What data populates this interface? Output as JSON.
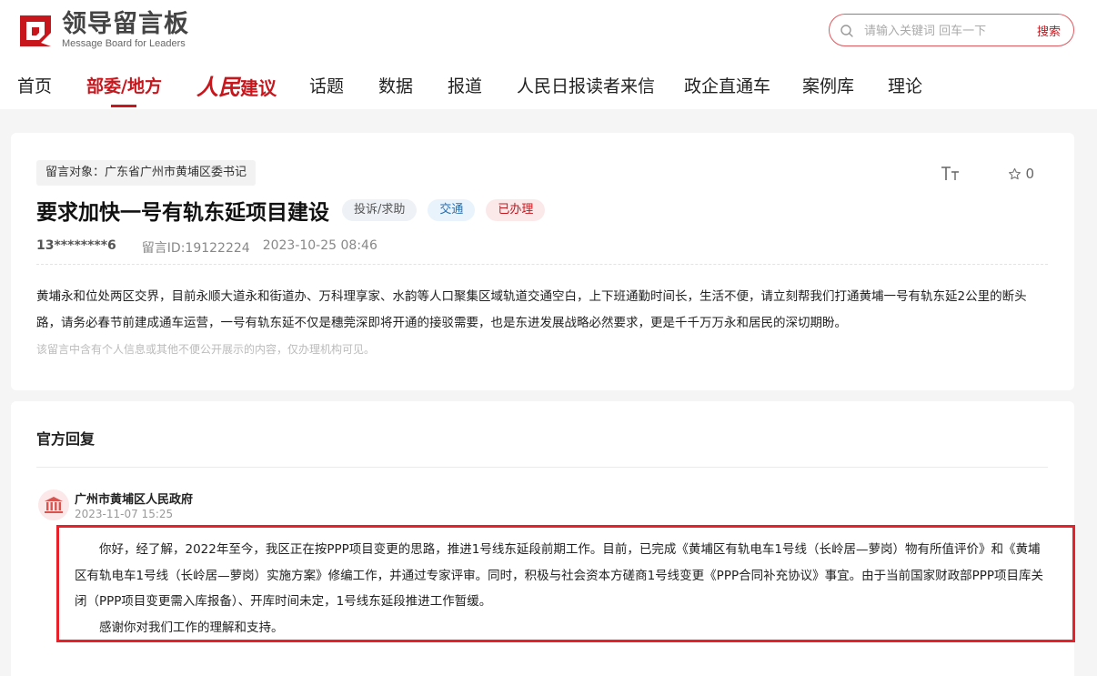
{
  "header": {
    "logo_title": "领导留言板",
    "logo_subtitle": "Message Board for Leaders",
    "search": {
      "placeholder": "请输入关键词 回车一下",
      "button_label": "搜索"
    }
  },
  "nav": {
    "items": [
      {
        "label": "首页"
      },
      {
        "label": "部委/地方",
        "active": true
      },
      {
        "label_brush": "人民",
        "label_rest": "建议"
      },
      {
        "label": "话题"
      },
      {
        "label": "数据"
      },
      {
        "label": "报道"
      },
      {
        "label": "人民日报读者来信"
      },
      {
        "label": "政企直通车"
      },
      {
        "label": "案例库"
      },
      {
        "label": "理论"
      }
    ]
  },
  "message": {
    "target": "留言对象：广东省广州市黄埔区委书记",
    "title": "要求加快一号有轨东延项目建设",
    "tags": [
      "投诉/求助",
      "交通",
      "已办理"
    ],
    "user": "13********6",
    "message_id": "留言ID:19122224",
    "datetime": "2023-10-25 08:46",
    "favorite_count": "0",
    "body": "黄埔永和位处两区交界，目前永顺大道永和街道办、万科理享家、水韵等人口聚集区域轨道交通空白，上下班通勤时间长，生活不便，请立刻帮我们打通黄埔一号有轨东延2公里的断头路，请务必春节前建成通车运营，一号有轨东延不仅是穗莞深即将开通的接驳需要，也是东进发展战略必然要求，更是千千万万永和居民的深切期盼。",
    "privacy_note": "该留言中含有个人信息或其他不便公开展示的内容，仅办理机构可见。"
  },
  "reply": {
    "heading": "官方回复",
    "org": "广州市黄埔区人民政府",
    "datetime": "2023-11-07 15:25",
    "paragraph1": "你好，经了解，2022年至今，我区正在按PPP项目变更的思路，推进1号线东延段前期工作。目前，已完成《黄埔区有轨电车1号线（长岭居—萝岗）物有所值评价》和《黄埔区有轨电车1号线（长岭居—萝岗）实施方案》修编工作，并通过专家评审。同时，积极与社会资本方磋商1号线变更《PPP合同补充协议》事宜。由于当前国家财政部PPP项目库关闭（PPP项目变更需入库报备）、开库时间未定，1号线东延段推进工作暂缓。",
    "paragraph2": "感谢你对我们工作的理解和支持。"
  },
  "colors": {
    "accent": "#c8161d",
    "highlight_border": "#e8202a"
  }
}
